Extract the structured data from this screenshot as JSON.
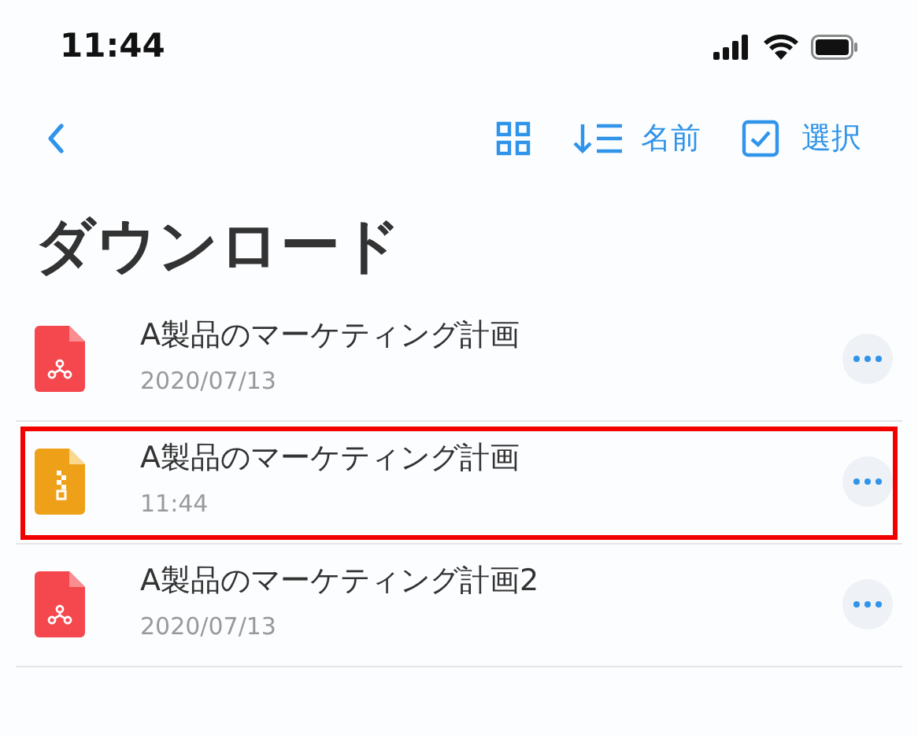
{
  "status_bar": {
    "time": "11:44"
  },
  "toolbar": {
    "sort_label": "名前",
    "select_label": "選択"
  },
  "title": "ダウンロード",
  "files": [
    {
      "kind": "pdf",
      "name": "A製品のマーケティング計画",
      "date": "2020/07/13",
      "highlighted": false
    },
    {
      "kind": "zip",
      "name": "A製品のマーケティング計画",
      "date": "11:44",
      "highlighted": true
    },
    {
      "kind": "pdf",
      "name": "A製品のマーケティング計画2",
      "date": "2020/07/13",
      "highlighted": false
    }
  ]
}
